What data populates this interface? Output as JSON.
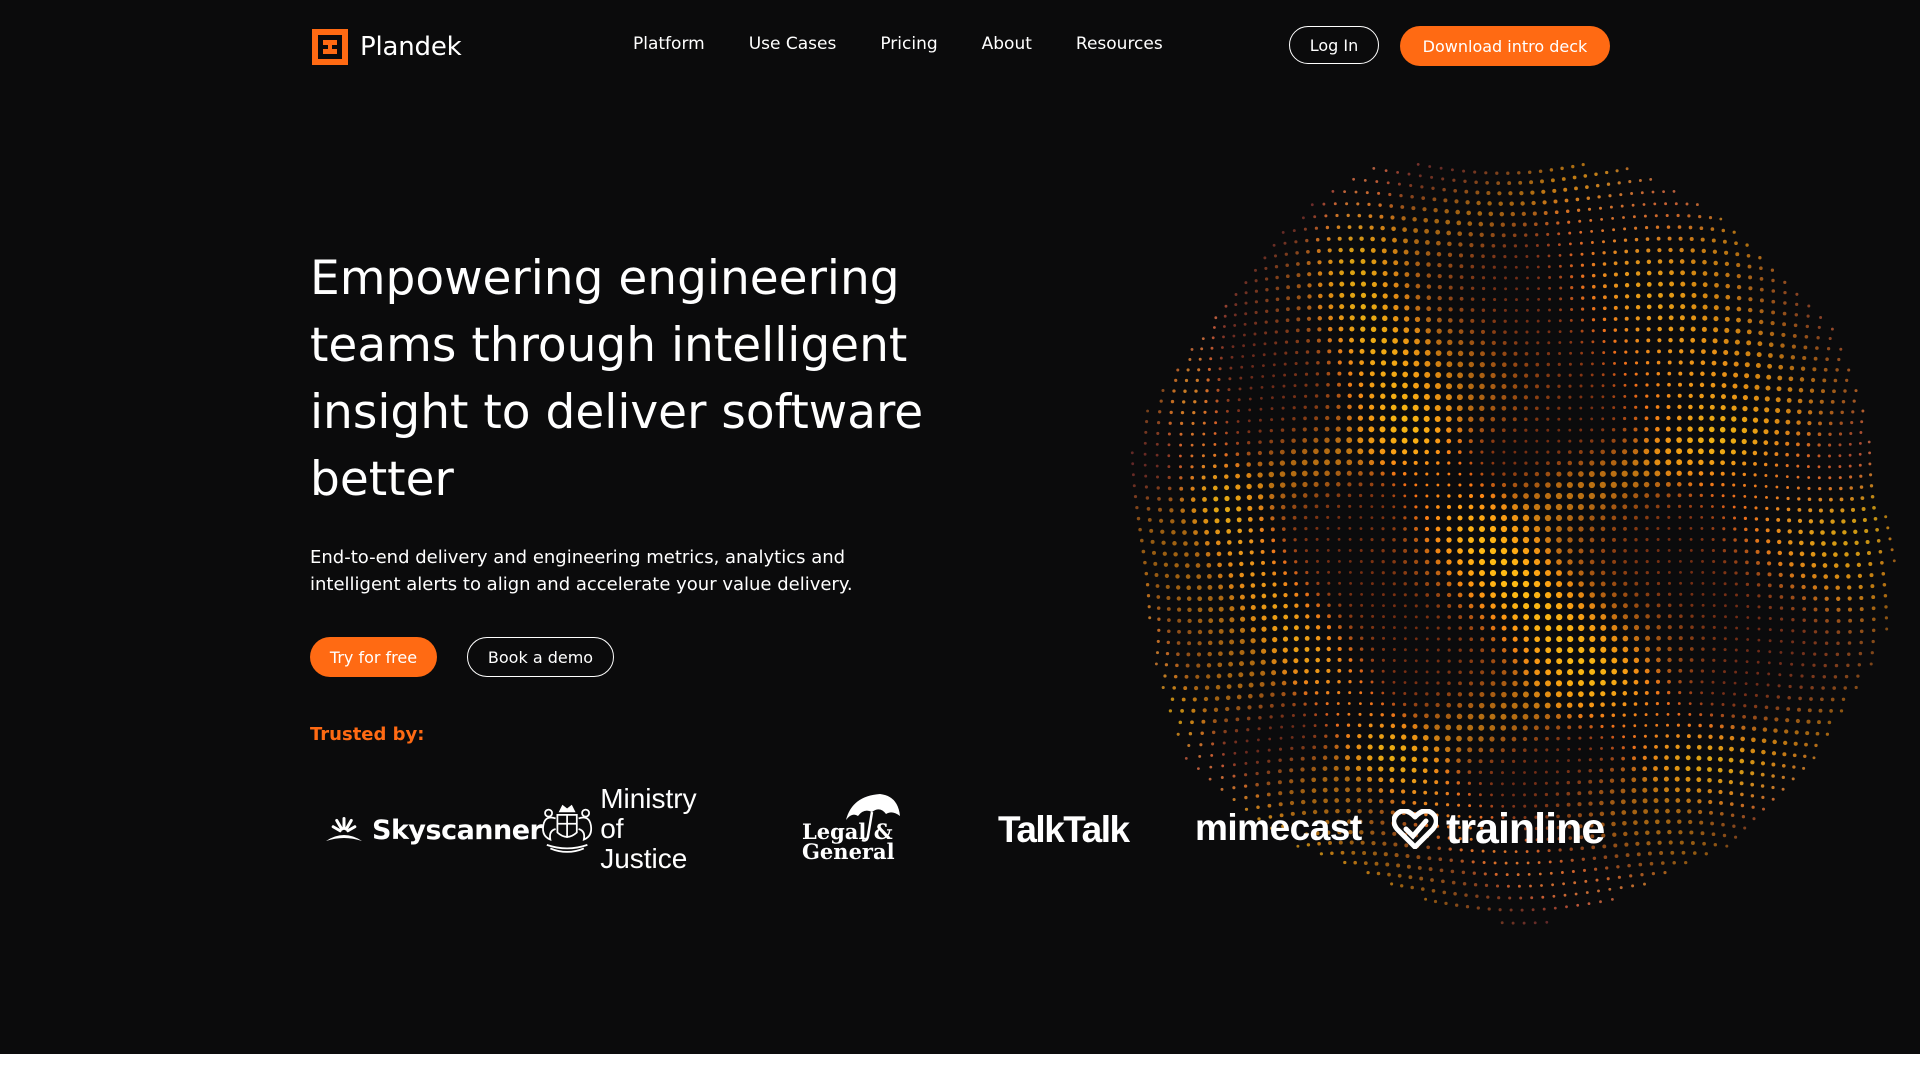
{
  "brand": {
    "name": "Plandek",
    "accent_color": "#ff6a13",
    "background_color": "#0b0b0c"
  },
  "nav": {
    "items": [
      {
        "label": "Platform"
      },
      {
        "label": "Use Cases"
      },
      {
        "label": "Pricing"
      },
      {
        "label": "About"
      },
      {
        "label": "Resources"
      }
    ],
    "login_label": "Log In",
    "cta_label": "Download intro deck"
  },
  "hero": {
    "headline": "Empowering engineering teams through intelligent insight to deliver software better",
    "subtext": "End-to-end delivery and engineering metrics, analytics and intelligent alerts to align and accelerate your value delivery.",
    "primary_cta": "Try for free",
    "secondary_cta": "Book a demo",
    "trusted_label": "Trusted by:",
    "visual": "orange-dotted-sphere"
  },
  "clients": {
    "skyscanner": "Skyscanner",
    "moj_line1": "Ministry",
    "moj_line2": "of Justice",
    "lg_line1": "Legal &",
    "lg_line2": "General",
    "talktalk": "TalkTalk",
    "mimecast": "mimecast",
    "trainline": "trainline"
  },
  "icons": {
    "logo": "plandek-logo-icon",
    "skyscanner": "sunrise-icon",
    "moj": "royal-crest-icon",
    "lg": "umbrella-icon",
    "trainline": "heart-check-icon"
  }
}
